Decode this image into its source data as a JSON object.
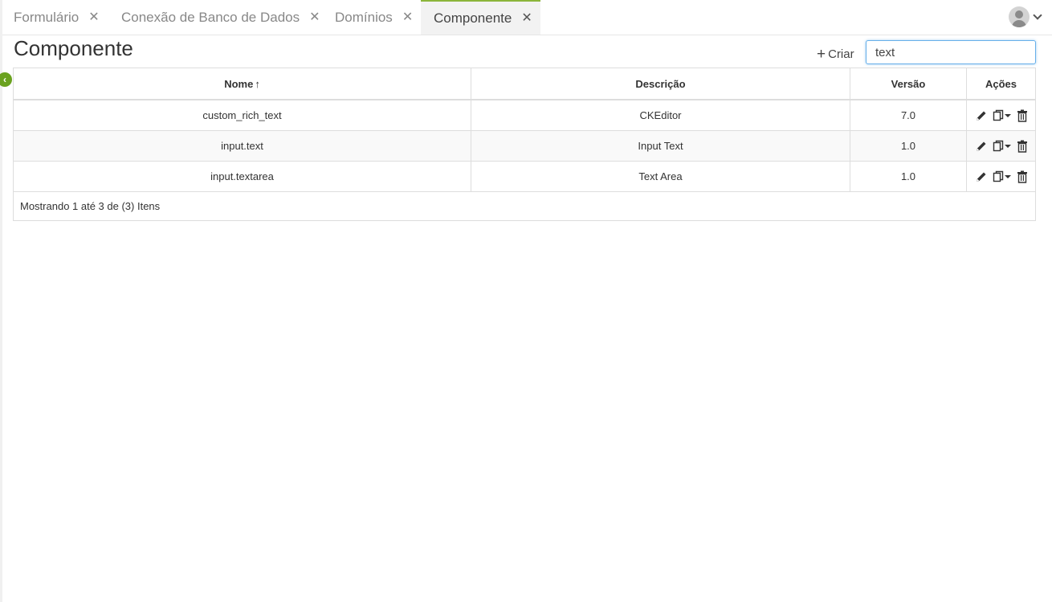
{
  "tabs": [
    {
      "label": "Formulário",
      "close": "✕"
    },
    {
      "label": "Conexão de Banco de Dados",
      "close": "✕"
    },
    {
      "label": "Domínios",
      "close": "✕"
    },
    {
      "label": "Componente",
      "close": "✕",
      "active": true
    }
  ],
  "page": {
    "title": "Componente",
    "create_label": "Criar",
    "create_icon": "+"
  },
  "search": {
    "value": "text",
    "placeholder": ""
  },
  "sidebar_toggle": {
    "icon": "chevron-left-icon",
    "glyph": "‹"
  },
  "table": {
    "headers": {
      "nome": "Nome",
      "sort_indicator": "🡑",
      "descricao": "Descrição",
      "versao": "Versão",
      "acoes": "Ações"
    },
    "rows": [
      {
        "nome": "custom_rich_text",
        "descricao": "CKEditor",
        "versao": "7.0"
      },
      {
        "nome": "input.text",
        "descricao": "Input Text",
        "versao": "1.0"
      },
      {
        "nome": "input.textarea",
        "descricao": "Text Area",
        "versao": "1.0"
      }
    ],
    "footer": "Mostrando 1 até 3 de (3) Itens"
  },
  "colors": {
    "accent": "#8bb53a",
    "toggle": "#6aa21f",
    "focus_border": "#66afe9"
  }
}
